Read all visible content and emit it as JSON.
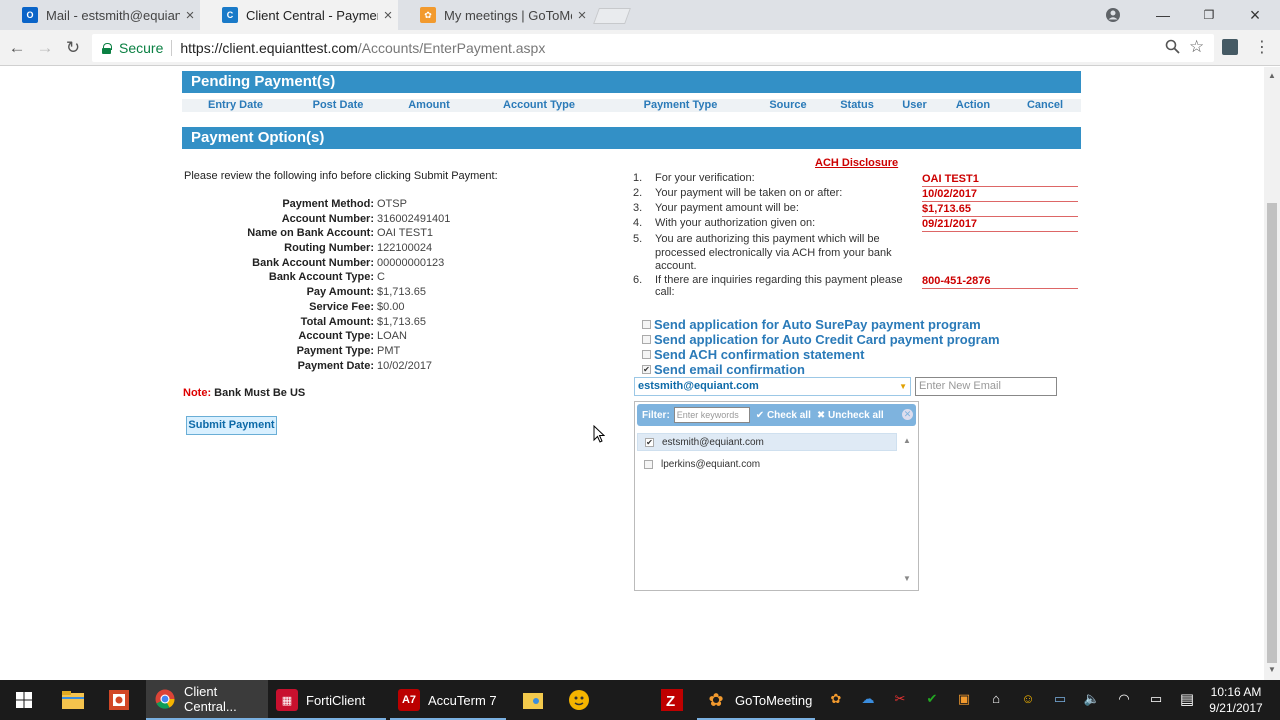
{
  "browser": {
    "tabs": [
      {
        "title": "Mail - estsmith@equiant",
        "icon": "outlook-icon",
        "active": false
      },
      {
        "title": "Client Central - Payments",
        "icon": "client-central-icon",
        "active": true
      },
      {
        "title": "My meetings | GoToMeeting",
        "icon": "gotomeeting-icon",
        "active": false
      }
    ],
    "secure_label": "Secure",
    "url_host": "https://client.equianttest.com",
    "url_path": "/Accounts/EnterPayment.aspx"
  },
  "pending": {
    "title": "Pending Payment(s)",
    "columns": [
      "Entry Date",
      "Post Date",
      "Amount",
      "Account Type",
      "Payment Type",
      "Source",
      "Status",
      "User",
      "Action",
      "Cancel"
    ]
  },
  "options": {
    "title": "Payment Option(s)",
    "review_text": "Please review the following info before clicking Submit Payment:",
    "details": [
      {
        "label": "Payment Method:",
        "value": "OTSP"
      },
      {
        "label": "Account Number:",
        "value": "316002491401"
      },
      {
        "label": "Name on Bank Account:",
        "value": "OAI TEST1"
      },
      {
        "label": "Routing Number:",
        "value": "122100024"
      },
      {
        "label": "Bank Account Number:",
        "value": "00000000123"
      },
      {
        "label": "Bank Account Type:",
        "value": "C"
      },
      {
        "label": "Pay Amount:",
        "value": "$1,713.65"
      },
      {
        "label": "Service Fee:",
        "value": "$0.00"
      },
      {
        "label": "Total Amount:",
        "value": "$1,713.65"
      },
      {
        "label": "Account Type:",
        "value": "LOAN"
      },
      {
        "label": "Payment Type:",
        "value": "PMT"
      },
      {
        "label": "Payment Date:",
        "value": "10/02/2017"
      }
    ],
    "note_label": "Note:",
    "note_text": "Bank Must Be US",
    "submit_label": "Submit Payment"
  },
  "ach": {
    "title": "ACH Disclosure",
    "items": [
      {
        "num": "1.",
        "text": "For your verification:",
        "value": "OAI TEST1"
      },
      {
        "num": "2.",
        "text": "Your payment will be taken on or after:",
        "value": "10/02/2017"
      },
      {
        "num": "3.",
        "text": "Your payment amount will be:",
        "value": "$1,713.65"
      },
      {
        "num": "4.",
        "text": "With your authorization given on:",
        "value": "09/21/2017"
      },
      {
        "num": "5.",
        "text": "You are authorizing this payment which will be processed electronically via ACH from your bank account.",
        "value": ""
      },
      {
        "num": "6.",
        "text": "If there are inquiries regarding this payment please call:",
        "value": "800-451-2876"
      }
    ]
  },
  "checkboxes": [
    {
      "label": "Send application for Auto SurePay payment program",
      "checked": false
    },
    {
      "label": "Send application for Auto Credit Card payment program",
      "checked": false
    },
    {
      "label": "Send ACH confirmation statement",
      "checked": false
    },
    {
      "label": "Send email confirmation",
      "checked": true
    }
  ],
  "email": {
    "selected": "estsmith@equiant.com",
    "new_placeholder": "Enter New Email",
    "filter_label": "Filter:",
    "filter_placeholder": "Enter keywords",
    "check_all": "Check all",
    "uncheck_all": "Uncheck all",
    "items": [
      {
        "address": "estsmith@equiant.com",
        "checked": true
      },
      {
        "address": "lperkins@equiant.com",
        "checked": false
      }
    ]
  },
  "taskbar": {
    "apps": [
      {
        "label": "Client Central...",
        "icon": "chrome-icon",
        "active": true
      },
      {
        "label": "FortiClient",
        "icon": "forticlient-icon",
        "active": false
      },
      {
        "label": "AccuTerm 7",
        "icon": "accuterm-icon",
        "active": false
      },
      {
        "label": "GoToMeeting",
        "icon": "gotomeeting-icon",
        "active": false
      }
    ],
    "time": "10:16 AM",
    "date": "9/21/2017"
  }
}
